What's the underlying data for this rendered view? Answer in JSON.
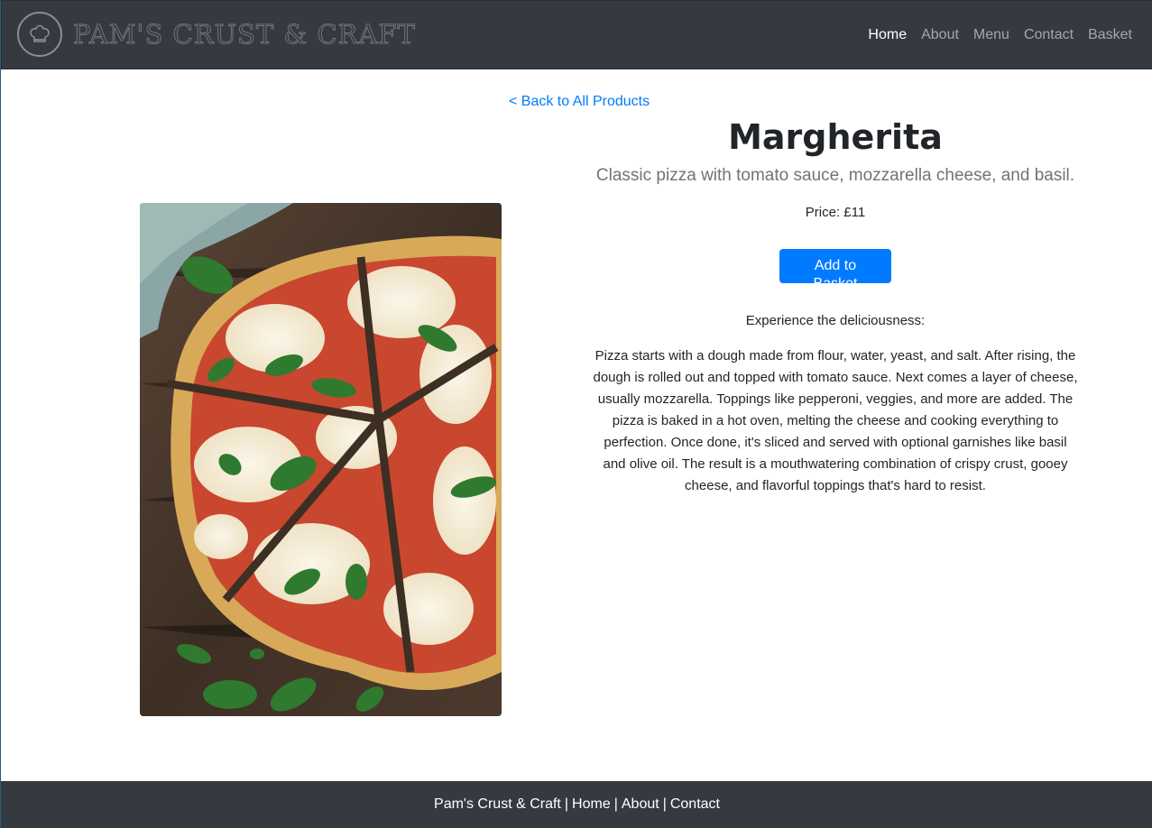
{
  "brand": {
    "name": "Pam's Crust & Craft",
    "logo_icon": "chef-hat-icon"
  },
  "nav": {
    "items": [
      {
        "label": "Home",
        "active": true
      },
      {
        "label": "About",
        "active": false
      },
      {
        "label": "Menu",
        "active": false
      },
      {
        "label": "Contact",
        "active": false
      },
      {
        "label": "Basket",
        "active": false
      }
    ]
  },
  "product": {
    "back_label": "< Back to All Products",
    "title": "Margherita",
    "subtitle": "Classic pizza with tomato sauce, mozzarella cheese, and basil.",
    "price_label": "Price: £11",
    "add_button_label": "Add to Basket",
    "experience_label": "Experience the deliciousness:",
    "description": "Pizza starts with a dough made from flour, water, yeast, and salt. After rising, the dough is rolled out and topped with tomato sauce. Next comes a layer of cheese, usually mozzarella. Toppings like pepperoni, veggies, and more are added. The pizza is baked in a hot oven, melting the cheese and cooking everything to perfection. Once done, it's sliced and served with optional garnishes like basil and olive oil. The result is a mouthwatering combination of crispy crust, gooey cheese, and flavorful toppings that's hard to resist."
  },
  "footer": {
    "brand": "Pam's Crust & Craft",
    "separator": "|",
    "links": [
      "Home",
      "About",
      "Contact"
    ]
  },
  "colors": {
    "navbar_bg": "#343a40",
    "accent": "#007bff",
    "text": "#212529",
    "muted": "#6c757d"
  }
}
